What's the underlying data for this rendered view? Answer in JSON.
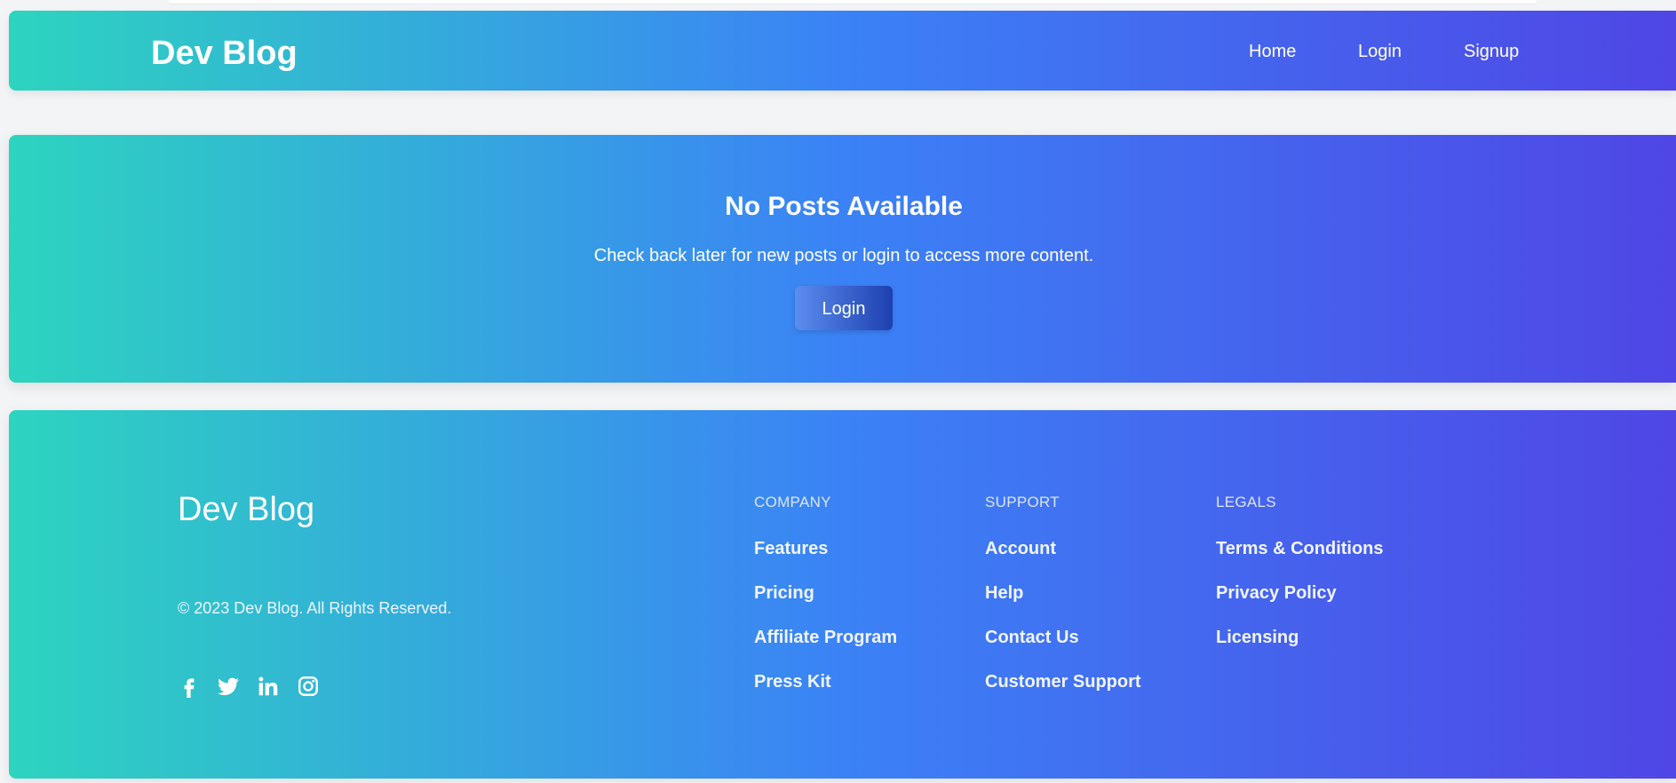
{
  "header": {
    "brand": "Dev Blog",
    "nav": [
      {
        "label": "Home"
      },
      {
        "label": "Login"
      },
      {
        "label": "Signup"
      }
    ]
  },
  "hero": {
    "title": "No Posts Available",
    "message": "Check back later for new posts or login to access more content.",
    "button_label": "Login"
  },
  "footer": {
    "brand": "Dev Blog",
    "copyright": "© 2023 Dev Blog. All Rights Reserved.",
    "social": [
      "facebook-icon",
      "twitter-icon",
      "linkedin-icon",
      "instagram-icon"
    ],
    "columns": [
      {
        "title": "COMPANY",
        "links": [
          "Features",
          "Pricing",
          "Affiliate Program",
          "Press Kit"
        ]
      },
      {
        "title": "SUPPORT",
        "links": [
          "Account",
          "Help",
          "Contact Us",
          "Customer Support"
        ]
      },
      {
        "title": "LEGALS",
        "links": [
          "Terms & Conditions",
          "Privacy Policy",
          "Licensing"
        ]
      }
    ]
  },
  "colors": {
    "gradient_start": "#2dd4bf",
    "gradient_mid": "#3b82f6",
    "gradient_end": "#4f46e5",
    "page_background": "#f3f4f6"
  }
}
